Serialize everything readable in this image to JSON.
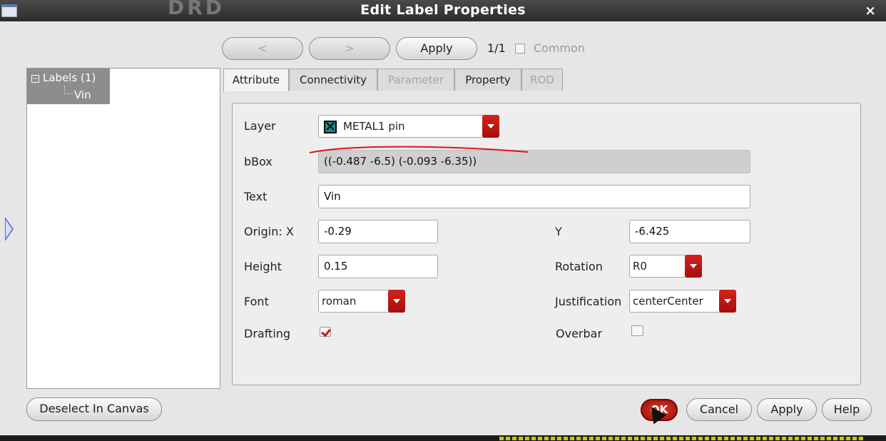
{
  "window": {
    "title": "Edit Label Properties",
    "close_glyph": "×",
    "background_fragment": "DRD"
  },
  "nav": {
    "prev_glyph": "<",
    "next_glyph": ">",
    "apply_label": "Apply",
    "counter": "1/1",
    "common_label": "Common"
  },
  "tree": {
    "root_label": "Labels (1)",
    "expander": "−",
    "child_label": "Vin"
  },
  "tabs": [
    {
      "label": "Attribute"
    },
    {
      "label": "Connectivity"
    },
    {
      "label": "Parameter"
    },
    {
      "label": "Property"
    },
    {
      "label": "ROD"
    }
  ],
  "form": {
    "layer_label": "Layer",
    "layer_value": "METAL1 pin",
    "bbox_label": "bBox",
    "bbox_value": "((-0.487 -6.5) (-0.093 -6.35))",
    "text_label": "Text",
    "text_value": "Vin",
    "origin_x_label": "Origin: X",
    "origin_x_value": "-0.29",
    "y_label": "Y",
    "y_value": "-6.425",
    "height_label": "Height",
    "height_value": "0.15",
    "rotation_label": "Rotation",
    "rotation_value": "R0",
    "font_label": "Font",
    "font_value": "roman",
    "justification_label": "Justification",
    "justification_value": "centerCenter",
    "drafting_label": "Drafting",
    "drafting_checked": true,
    "overbar_label": "Overbar",
    "overbar_checked": false
  },
  "footer": {
    "deselect_label": "Deselect In Canvas",
    "ok_label": "OK",
    "cancel_label": "Cancel",
    "apply_label": "Apply",
    "help_label": "Help"
  },
  "colors": {
    "accent_red": "#c8161a",
    "layer_swatch": "#1a8c8c",
    "annotation_stroke": "#e0141c"
  },
  "icons": [
    "window-menu-icon",
    "close-icon",
    "expand-handle-icon",
    "layer-color-icon",
    "dropdown-arrow-icon",
    "check-icon",
    "mouse-pointer-icon"
  ]
}
